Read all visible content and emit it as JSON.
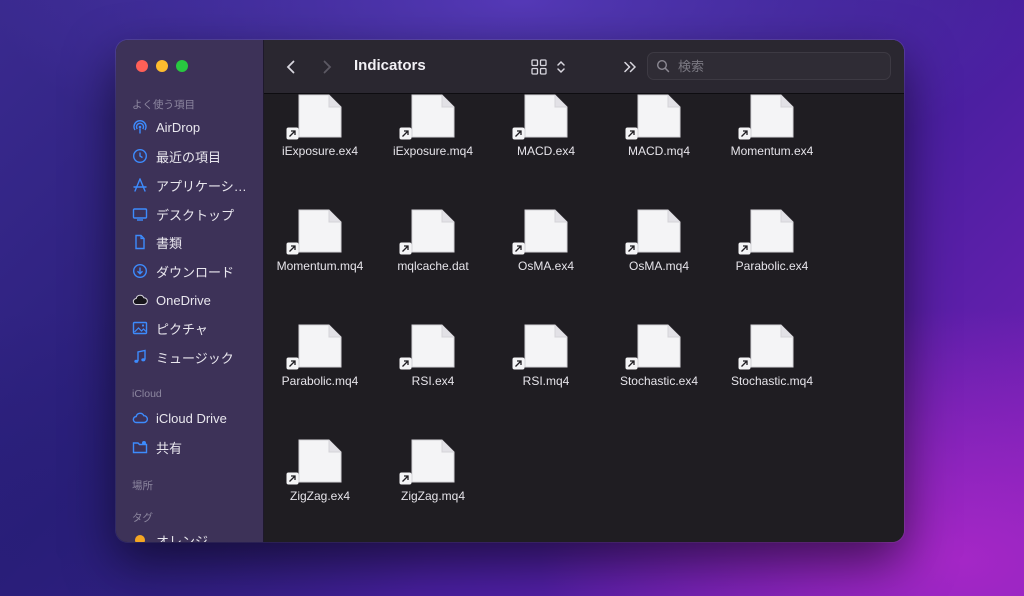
{
  "sidebar": {
    "favorites_title": "よく使う項目",
    "favorites": [
      {
        "label": "AirDrop",
        "icon": "airdrop-icon"
      },
      {
        "label": "最近の項目",
        "icon": "clock-icon"
      },
      {
        "label": "アプリケーシ…",
        "icon": "applications-icon"
      },
      {
        "label": "デスクトップ",
        "icon": "desktop-icon"
      },
      {
        "label": "書類",
        "icon": "document-icon"
      },
      {
        "label": "ダウンロード",
        "icon": "download-icon"
      },
      {
        "label": "OneDrive",
        "icon": "cloud-filled-icon"
      },
      {
        "label": "ピクチャ",
        "icon": "photo-icon"
      },
      {
        "label": "ミュージック",
        "icon": "music-icon"
      }
    ],
    "icloud_title": "iCloud",
    "icloud": [
      {
        "label": "iCloud Drive",
        "icon": "cloud-icon"
      },
      {
        "label": "共有",
        "icon": "shared-folder-icon"
      }
    ],
    "locations_title": "場所",
    "tags_title": "タグ",
    "tags": [
      {
        "label": "オレンジ",
        "color": "#f5a623"
      }
    ]
  },
  "toolbar": {
    "title": "Indicators",
    "search_placeholder": "検索"
  },
  "files": [
    "iExposure.ex4",
    "iExposure.mq4",
    "MACD.ex4",
    "MACD.mq4",
    "Momentum.ex4",
    "Momentum.mq4",
    "mqlcache.dat",
    "OsMA.ex4",
    "OsMA.mq4",
    "Parabolic.ex4",
    "Parabolic.mq4",
    "RSI.ex4",
    "RSI.mq4",
    "Stochastic.ex4",
    "Stochastic.mq4",
    "ZigZag.ex4",
    "ZigZag.mq4"
  ],
  "colors": {
    "accent": "#3d8bfd",
    "window_bg": "#1f1d22",
    "sidebar_bg": "#40345c"
  }
}
